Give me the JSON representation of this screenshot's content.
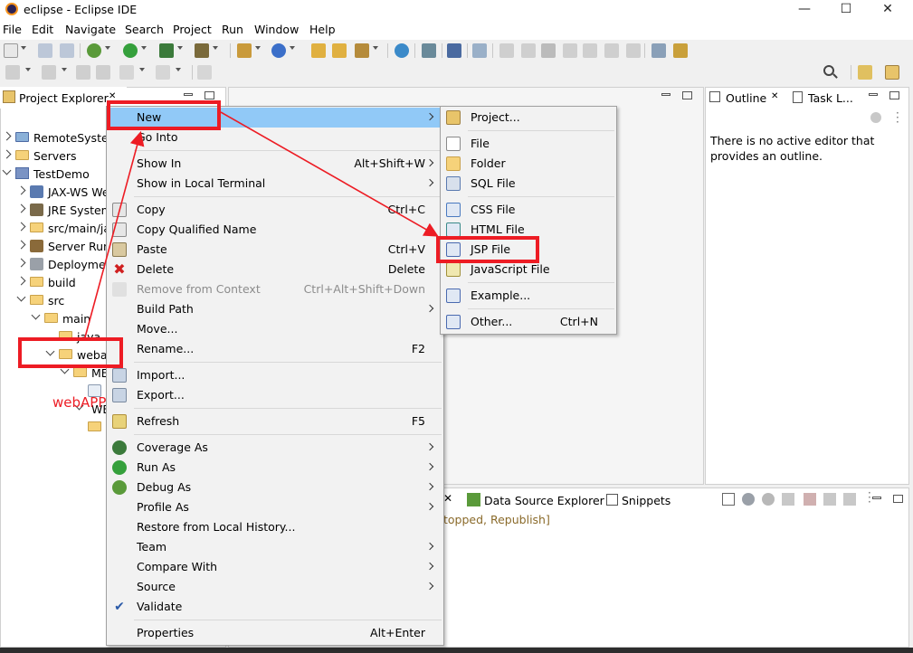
{
  "window": {
    "title": "eclipse - Eclipse IDE",
    "minimize": "—",
    "maximize": "☐",
    "close": "✕"
  },
  "menubar": [
    "File",
    "Edit",
    "Navigate",
    "Search",
    "Project",
    "Run",
    "Window",
    "Help"
  ],
  "project_explorer": {
    "tab_label": "Project Explorer",
    "close_glyph": "✕",
    "tree": [
      {
        "label": "RemoteSysten"
      },
      {
        "label": "Servers"
      },
      {
        "label": "TestDemo"
      },
      {
        "label": "JAX-WS We"
      },
      {
        "label": "JRE System"
      },
      {
        "label": "src/main/ja"
      },
      {
        "label": "Server Runt"
      },
      {
        "label": "Deploymen"
      },
      {
        "label": "build"
      },
      {
        "label": "src"
      },
      {
        "label": "main"
      },
      {
        "label": "java"
      },
      {
        "label": "weba"
      },
      {
        "label": "ME"
      },
      {
        "label": "WE"
      }
    ]
  },
  "annotation": {
    "webapp_label": "webAPP"
  },
  "context_menu": {
    "items": [
      {
        "label": "New",
        "accel": "",
        "submenu": true,
        "disabled": false,
        "highlight": true
      },
      {
        "label": "Go Into",
        "accel": "",
        "submenu": false,
        "disabled": false
      },
      {
        "label": "Show In",
        "accel": "Alt+Shift+W",
        "submenu": true,
        "disabled": false
      },
      {
        "label": "Show in Local Terminal",
        "accel": "",
        "submenu": true,
        "disabled": false
      },
      {
        "label": "Copy",
        "accel": "Ctrl+C",
        "submenu": false,
        "disabled": false
      },
      {
        "label": "Copy Qualified Name",
        "accel": "",
        "submenu": false,
        "disabled": false
      },
      {
        "label": "Paste",
        "accel": "Ctrl+V",
        "submenu": false,
        "disabled": false
      },
      {
        "label": "Delete",
        "accel": "Delete",
        "submenu": false,
        "disabled": false
      },
      {
        "label": "Remove from Context",
        "accel": "Ctrl+Alt+Shift+Down",
        "submenu": false,
        "disabled": true
      },
      {
        "label": "Build Path",
        "accel": "",
        "submenu": true,
        "disabled": false
      },
      {
        "label": "Move...",
        "accel": "",
        "submenu": false,
        "disabled": false
      },
      {
        "label": "Rename...",
        "accel": "F2",
        "submenu": false,
        "disabled": false
      },
      {
        "label": "Import...",
        "accel": "",
        "submenu": false,
        "disabled": false
      },
      {
        "label": "Export...",
        "accel": "",
        "submenu": false,
        "disabled": false
      },
      {
        "label": "Refresh",
        "accel": "F5",
        "submenu": false,
        "disabled": false
      },
      {
        "label": "Coverage As",
        "accel": "",
        "submenu": true,
        "disabled": false
      },
      {
        "label": "Run As",
        "accel": "",
        "submenu": true,
        "disabled": false
      },
      {
        "label": "Debug As",
        "accel": "",
        "submenu": true,
        "disabled": false
      },
      {
        "label": "Profile As",
        "accel": "",
        "submenu": true,
        "disabled": false
      },
      {
        "label": "Restore from Local History...",
        "accel": "",
        "submenu": false,
        "disabled": false
      },
      {
        "label": "Team",
        "accel": "",
        "submenu": true,
        "disabled": false
      },
      {
        "label": "Compare With",
        "accel": "",
        "submenu": true,
        "disabled": false
      },
      {
        "label": "Source",
        "accel": "",
        "submenu": true,
        "disabled": false
      },
      {
        "label": "Validate",
        "accel": "",
        "submenu": false,
        "disabled": false,
        "checked": true
      },
      {
        "label": "Properties",
        "accel": "Alt+Enter",
        "submenu": false,
        "disabled": false
      }
    ]
  },
  "new_submenu": {
    "items": [
      {
        "label": "Project...",
        "accel": ""
      },
      {
        "label": "File",
        "accel": ""
      },
      {
        "label": "Folder",
        "accel": ""
      },
      {
        "label": "SQL File",
        "accel": ""
      },
      {
        "label": "CSS File",
        "accel": ""
      },
      {
        "label": "HTML File",
        "accel": ""
      },
      {
        "label": "JSP File",
        "accel": ""
      },
      {
        "label": "JavaScript File",
        "accel": ""
      },
      {
        "label": "Example...",
        "accel": ""
      },
      {
        "label": "Other...",
        "accel": "Ctrl+N"
      }
    ]
  },
  "outline": {
    "tab_label": "Outline",
    "close_glyph": "✕",
    "task_tab_label": "Task L...",
    "message_line1": "There is no active editor that",
    "message_line2": "provides an outline."
  },
  "bottom_panel": {
    "tabs": [
      "Data Source Explorer",
      "Snippets"
    ],
    "server_text": "topped, Republish]"
  },
  "colors": {
    "highlight": "#91c9f7",
    "annotation": "#ed1c24"
  }
}
